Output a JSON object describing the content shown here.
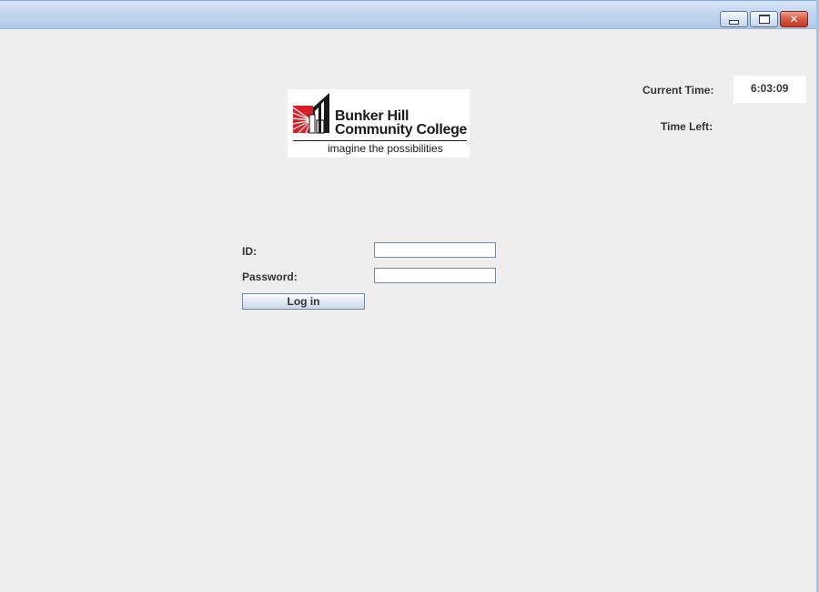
{
  "window": {
    "controls": {
      "minimize_icon": "minimize-icon",
      "maximize_icon": "restore-icon",
      "close_icon": "close-icon",
      "close_color": "#d85a44"
    }
  },
  "logo": {
    "line1": "Bunker Hill",
    "line2": "Community College",
    "tagline": "imagine the possibilities",
    "emblem_icon": "bhcc-emblem-icon",
    "brand_color": "#d81f26"
  },
  "clock": {
    "current_time_label": "Current Time:",
    "current_time_value": "6:03:09",
    "time_left_label": "Time Left:"
  },
  "login_form": {
    "id_label": "ID:",
    "id_value": "",
    "password_label": "Password:",
    "password_value": "",
    "login_button": "Log in"
  }
}
